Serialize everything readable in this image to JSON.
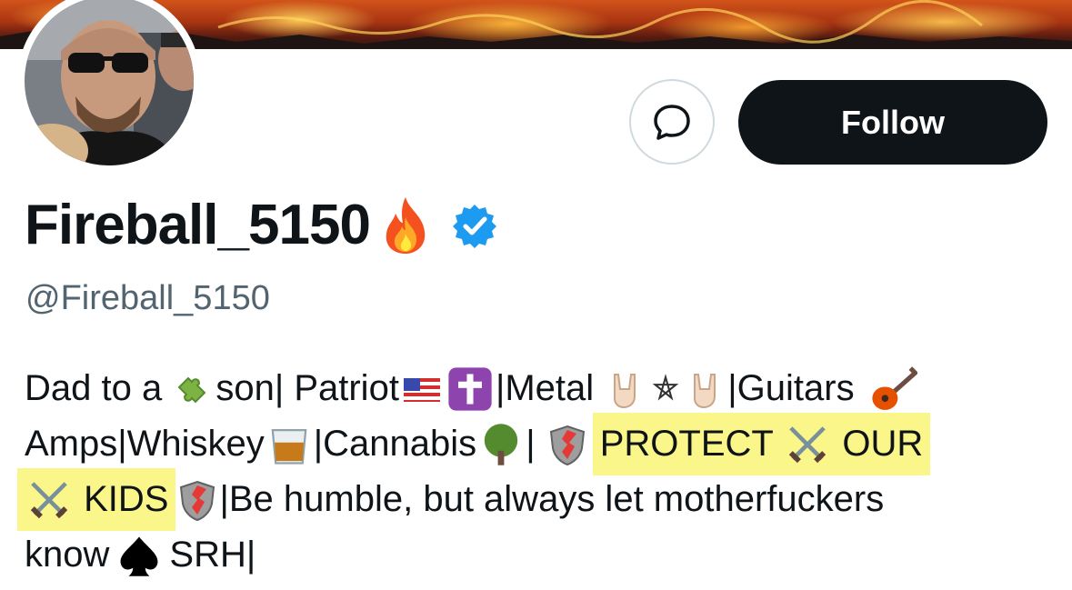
{
  "profile": {
    "display_name": "Fireball_5150",
    "handle": "@Fireball_5150",
    "verified": true,
    "name_emoji": "fire-icon"
  },
  "actions": {
    "message_icon": "message-bubble-icon",
    "follow_label": "Follow"
  },
  "bio": {
    "l1_a": "Dad to a ",
    "l1_b": "son| Patriot",
    "l1_c": "|Metal ",
    "l1_d": "|Guitars ",
    "l2_a": "Amps|Whiskey",
    "l2_b": "|Cannabis",
    "l2_c": "| ",
    "l2_d": "PROTECT ",
    "l2_e": " OUR",
    "l3_a": " KIDS",
    "l3_b": "|Be humble, but always let motherfuckers",
    "l4_a": "know",
    "l4_b": "SRH|"
  },
  "colors": {
    "follow_bg": "#0f1419",
    "handle": "#536471",
    "verified": "#1d9bf0",
    "highlight": "#fbf68a"
  }
}
